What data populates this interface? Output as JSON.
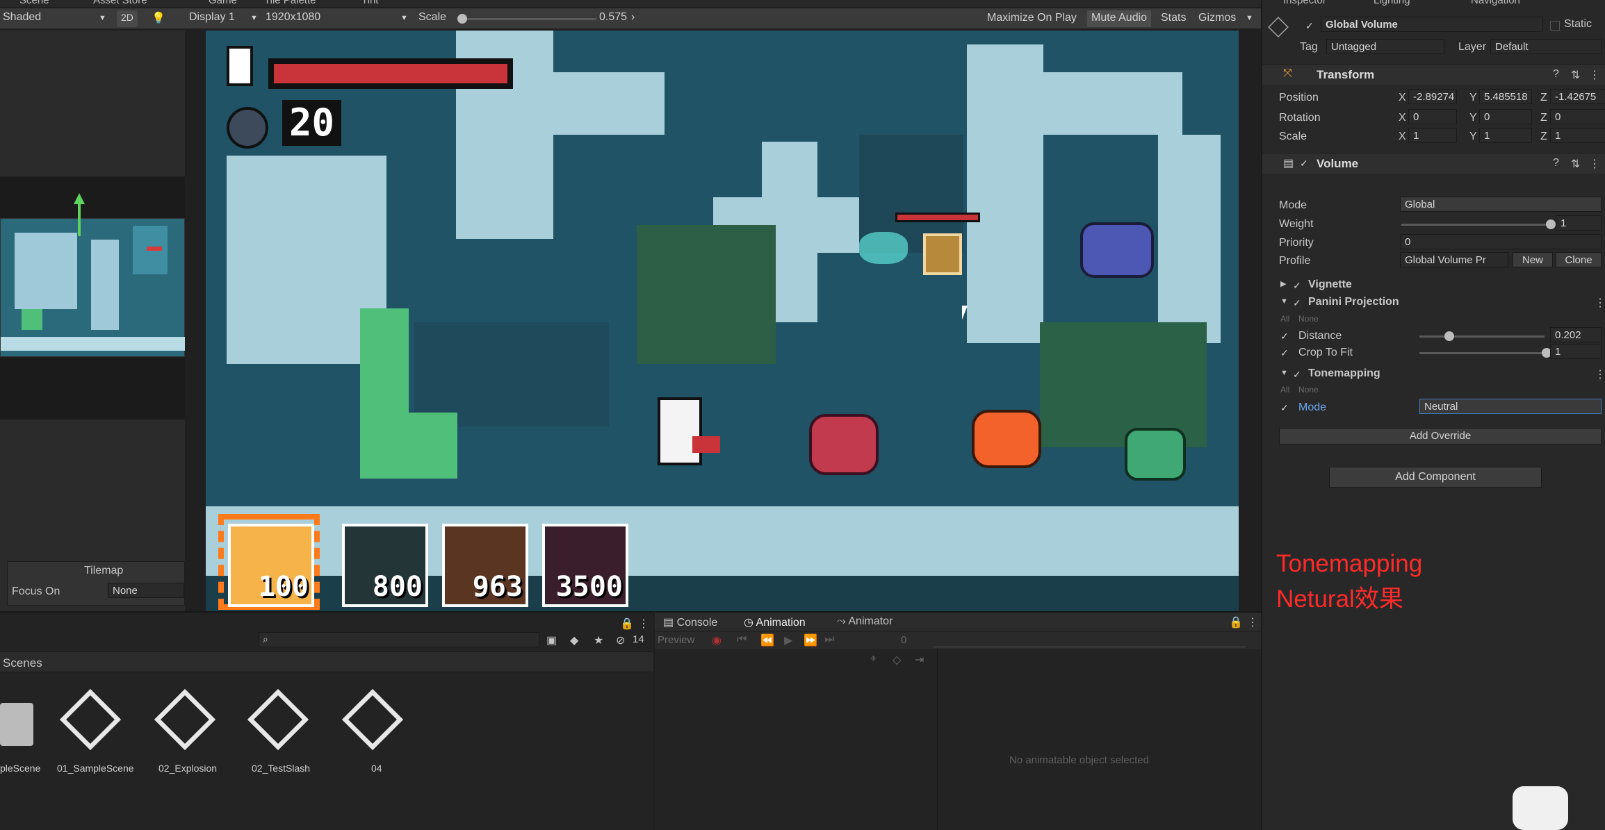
{
  "tabs": {
    "scene": "Scene",
    "asset_store": "Asset Store",
    "game": "Game",
    "tile_palette": "Tile Palette",
    "tint": "Tint"
  },
  "scene_toolbar": {
    "shading": "Shaded",
    "mode_2d": "2D"
  },
  "game_toolbar": {
    "display": "Display 1",
    "resolution": "1920x1080",
    "scale_label": "Scale",
    "scale_value": "0.575",
    "maximize_on_play": "Maximize On Play",
    "mute_audio": "Mute Audio",
    "stats": "Stats",
    "gizmos": "Gizmos"
  },
  "scene_overlay": {
    "title": "Tilemap",
    "focus_on_label": "Focus On",
    "focus_on_value": "None"
  },
  "hud": {
    "bombs": "20",
    "health_fraction": 1.0,
    "slots": [
      {
        "value": "100"
      },
      {
        "value": "800"
      },
      {
        "value": "963"
      },
      {
        "value": "3500"
      }
    ]
  },
  "inspector": {
    "tabs": {
      "inspector": "Inspector",
      "lighting": "Lighting",
      "navigation": "Navigation"
    },
    "object_name": "Global Volume",
    "static_label": "Static",
    "tag_label": "Tag",
    "tag_value": "Untagged",
    "layer_label": "Layer",
    "layer_value": "Default",
    "transform": {
      "title": "Transform",
      "position_label": "Position",
      "rotation_label": "Rotation",
      "scale_label": "Scale",
      "position": {
        "x": "-2.89274",
        "y": "5.485518",
        "z": "-1.42675"
      },
      "rotation": {
        "x": "0",
        "y": "0",
        "z": "0"
      },
      "scale": {
        "x": "1",
        "y": "1",
        "z": "1"
      },
      "x": "X",
      "y": "Y",
      "z": "Z"
    },
    "volume": {
      "title": "Volume",
      "mode_label": "Mode",
      "mode_value": "Global",
      "weight_label": "Weight",
      "weight_value": "1",
      "priority_label": "Priority",
      "priority_value": "0",
      "profile_label": "Profile",
      "profile_value": "Global Volume Pr",
      "new_button": "New",
      "clone_button": "Clone"
    },
    "overrides": {
      "vignette": "Vignette",
      "panini": "Panini Projection",
      "all": "All",
      "none": "None",
      "distance_label": "Distance",
      "distance_value": "0.202",
      "crop_label": "Crop To Fit",
      "crop_value": "1",
      "tonemapping": "Tonemapping",
      "tm_mode_label": "Mode",
      "tm_mode_value": "Neutral"
    },
    "add_override": "Add Override",
    "add_component": "Add Component"
  },
  "annotation": {
    "line1": "Tonemapping",
    "line2": "Netural效果"
  },
  "project": {
    "header": "Scenes",
    "hidden_count": "14",
    "assets": [
      {
        "name": "pleScene"
      },
      {
        "name": "01_SampleScene"
      },
      {
        "name": "02_Explosion"
      },
      {
        "name": "02_TestSlash"
      },
      {
        "name": "04"
      }
    ]
  },
  "bottom_tabs": {
    "console": "Console",
    "animation": "Animation",
    "animator": "Animator"
  },
  "animation": {
    "preview": "Preview",
    "frame": "0",
    "empty_message": "No animatable object selected"
  },
  "colors": {
    "accent_blue": "#3d7ac2",
    "annotation_red": "#ff2a2a",
    "health_red": "#c8343a",
    "hud_orange": "#ff7a1a"
  }
}
